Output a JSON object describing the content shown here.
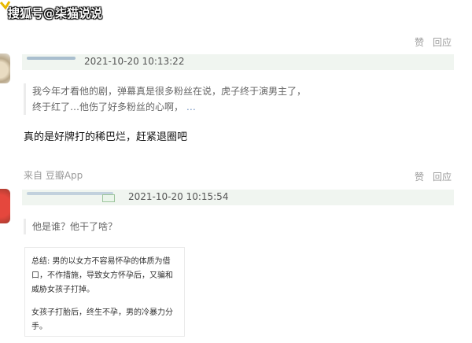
{
  "watermark": "搜狐号@柒猫说说",
  "comment1": {
    "actions": [
      "赞",
      "回应"
    ],
    "timestamp": "2021-10-20 10:13:22",
    "quoted_text": "我今年才看他的剧，弹幕真是很多粉丝在说，虎子终于演男主了，终于红了…他伤了好多粉丝的心啊，",
    "quoted_more": "…",
    "reply": "真的是好牌打的稀巴烂，赶紧退圈吧",
    "source": "来自 豆瓣App"
  },
  "comment2": {
    "actions": [
      "赞",
      "回应"
    ],
    "timestamp": "2021-10-20 10:15:54",
    "quoted_text": "他是谁？他干了啥？",
    "snippet_paragraph1": "总结: 男的以女方不容易怀孕的体质为借口，不作措施，导致女方怀孕后，又骗和威胁女孩子打掉。",
    "snippet_paragraph2": "女孩子打胎后，终生不孕，男的冷暴力分手。"
  }
}
